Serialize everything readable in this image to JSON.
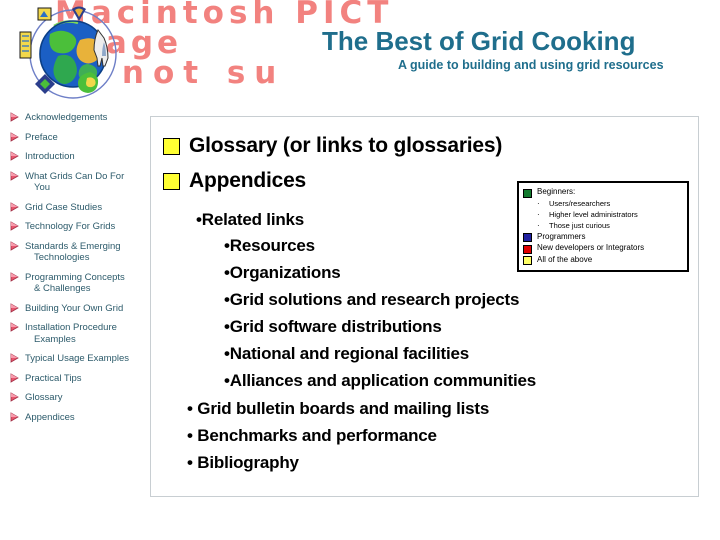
{
  "banner": {
    "placeholder_lines": [
      "Macintosh PICT",
      "image",
      "is not su"
    ],
    "placeholder_color": "#F2827F",
    "artwork_name": "globe-with-orbiting-satellites"
  },
  "header": {
    "title": "The Best of Grid Cooking",
    "subtitle": "A guide to building and using grid resources",
    "title_color": "#1F6E8C"
  },
  "sidebar": {
    "items": [
      {
        "label": "Acknowledgements"
      },
      {
        "label": "Preface"
      },
      {
        "label": "Introduction"
      },
      {
        "label": "What Grids Can Do For",
        "label2": "You"
      },
      {
        "label": "Grid Case Studies"
      },
      {
        "label": "Technology For Grids"
      },
      {
        "label": "Standards & Emerging",
        "label2": "Technologies"
      },
      {
        "label": "Programming Concepts",
        "label2": "& Challenges"
      },
      {
        "label": "Building Your Own Grid"
      },
      {
        "label": "Installation Procedure",
        "label2": "Examples"
      },
      {
        "label": "Typical Usage Examples"
      },
      {
        "label": "Practical Tips"
      },
      {
        "label": "Glossary"
      },
      {
        "label": "Appendices"
      }
    ],
    "bullet_color": "#E8566E",
    "text_color": "#2D5B6B"
  },
  "content": {
    "headings": [
      {
        "label": "Glossary (or links to glossaries)",
        "marker_color": "#FFFF33"
      },
      {
        "label": "Appendices",
        "marker_color": "#FFFF33"
      }
    ],
    "bullets": [
      {
        "text": "Related links",
        "level": 2
      },
      {
        "text": "Resources",
        "level": 3
      },
      {
        "text": "Organizations",
        "level": 3
      },
      {
        "text": "Grid solutions and research projects",
        "level": 3
      },
      {
        "text": "Grid software distributions",
        "level": 3
      },
      {
        "text": "National and regional facilities",
        "level": 3
      },
      {
        "text": "Alliances and application communities",
        "level": 3
      },
      {
        "text": "Grid bulletin boards and mailing lists",
        "level": 2
      },
      {
        "text": "Benchmarks and performance",
        "level": 2
      },
      {
        "text": "Bibliography",
        "level": 2
      }
    ],
    "bullet_glyph": "•"
  },
  "legend": {
    "entries": [
      {
        "label": "Beginners:",
        "color": "#127A2E"
      },
      {
        "label": "Programmers",
        "color": "#2020A0"
      },
      {
        "label": "New developers or Integrators",
        "color": "#E00000"
      },
      {
        "label": "All of the above",
        "color": "#FFFF66"
      }
    ],
    "sub_entries": [
      {
        "label": "Users/researchers"
      },
      {
        "label": "Higher level administrators"
      },
      {
        "label": "Those just curious"
      }
    ],
    "sub_bullet_glyph": "·"
  }
}
